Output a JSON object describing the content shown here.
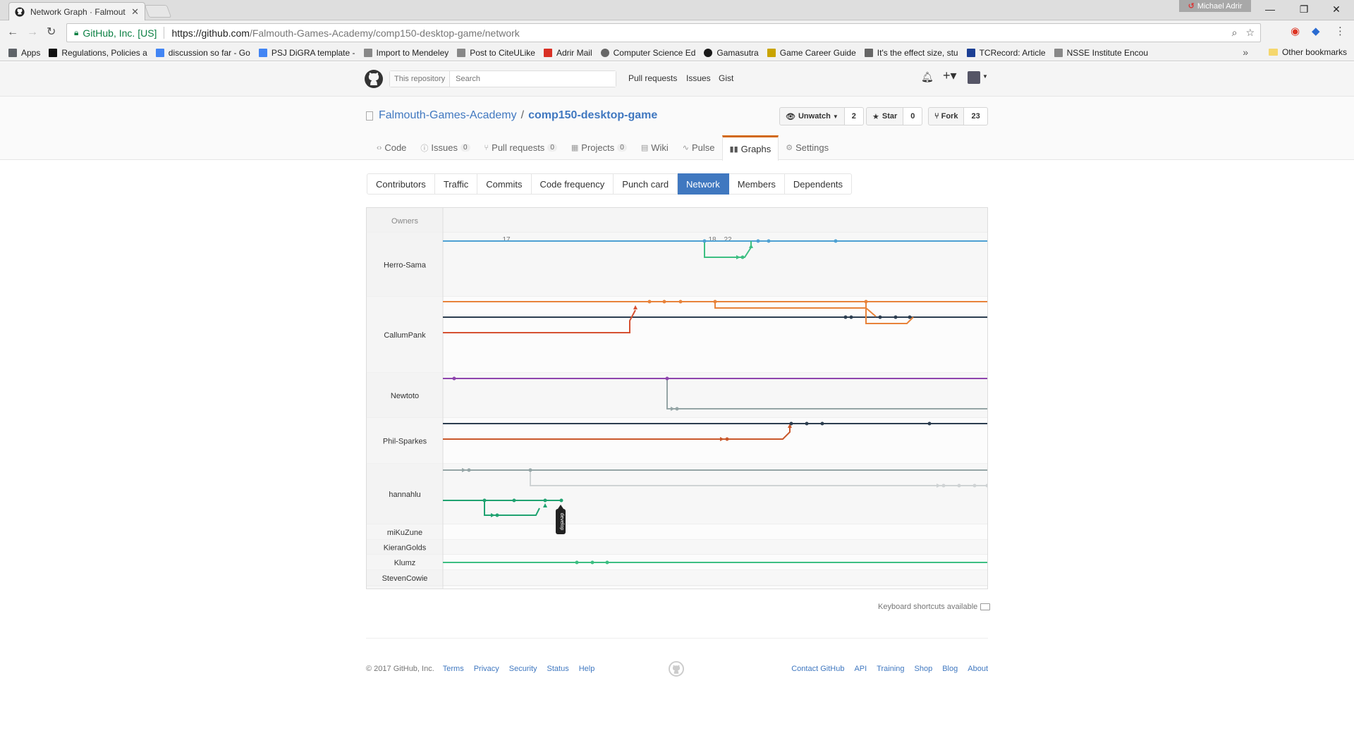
{
  "browser": {
    "tab_title": "Network Graph · Falmout",
    "profile_name": "Michael Adrir",
    "security_label": "GitHub, Inc. [US]",
    "url_host": "https://github.com",
    "url_path": "/Falmouth-Games-Academy/comp150-desktop-game/network",
    "bookmarks": [
      {
        "label": "Apps",
        "icon": "apps-grid-icon"
      },
      {
        "label": "Regulations, Policies a",
        "icon": "falmouth-icon"
      },
      {
        "label": "discussion so far - Go",
        "icon": "docs-icon"
      },
      {
        "label": "PSJ DiGRA template -",
        "icon": "docs-icon"
      },
      {
        "label": "Import to Mendeley",
        "icon": "page-icon"
      },
      {
        "label": "Post to CiteULike",
        "icon": "page-icon"
      },
      {
        "label": "Adrir Mail",
        "icon": "gmail-icon"
      },
      {
        "label": "Computer Science Ed",
        "icon": "globe-icon"
      },
      {
        "label": "Gamasutra",
        "icon": "gamasutra-icon"
      },
      {
        "label": "Game Career Guide",
        "icon": "gcg-icon"
      },
      {
        "label": "It's the effect size, stu",
        "icon": "pdf-icon"
      },
      {
        "label": "TCRecord: Article",
        "icon": "tc-icon"
      },
      {
        "label": "NSSE Institute Encou",
        "icon": "page-icon"
      }
    ],
    "other_bookmarks": "Other bookmarks"
  },
  "github": {
    "search_scope": "This repository",
    "search_placeholder": "Search",
    "nav": [
      "Pull requests",
      "Issues",
      "Gist"
    ],
    "repo_owner": "Falmouth-Games-Academy",
    "repo_name": "comp150-desktop-game",
    "unwatch_label": "Unwatch",
    "watch_count": "2",
    "star_label": "Star",
    "star_count": "0",
    "fork_label": "Fork",
    "fork_count": "23",
    "reponav": [
      {
        "label": "Code",
        "icon": "code-icon",
        "count": null
      },
      {
        "label": "Issues",
        "icon": "issue-icon",
        "count": "0"
      },
      {
        "label": "Pull requests",
        "icon": "pull-request-icon",
        "count": "0"
      },
      {
        "label": "Projects",
        "icon": "project-icon",
        "count": "0"
      },
      {
        "label": "Wiki",
        "icon": "wiki-icon",
        "count": null
      },
      {
        "label": "Pulse",
        "icon": "pulse-icon",
        "count": null
      },
      {
        "label": "Graphs",
        "icon": "graph-icon",
        "count": null,
        "selected": true
      },
      {
        "label": "Settings",
        "icon": "gear-icon",
        "count": null
      }
    ],
    "subnav": [
      {
        "label": "Contributors"
      },
      {
        "label": "Traffic"
      },
      {
        "label": "Commits"
      },
      {
        "label": "Code frequency"
      },
      {
        "label": "Punch card"
      },
      {
        "label": "Network",
        "selected": true
      },
      {
        "label": "Members"
      },
      {
        "label": "Dependents"
      }
    ]
  },
  "network": {
    "header": "Owners",
    "date_labels": [
      "17",
      "18",
      "22"
    ],
    "branch_label": "develop",
    "owners": [
      "Herro-Sama",
      "CallumPank",
      "Newtoto",
      "Phil-Sparkes",
      "hannahlu",
      "miKuZune",
      "KieranGolds",
      "Klumz",
      "StevenCowie"
    ],
    "colors": {
      "blue": "#4ea1d3",
      "green": "#3dbf82",
      "orange": "#e8833a",
      "navy": "#2c3e50",
      "red": "#d65132",
      "purple": "#8e44ad",
      "gray": "#95a5a6",
      "lightgray": "#cfd3d4",
      "darkorange": "#c9582b",
      "teal": "#20a371"
    }
  },
  "keyboard_note": "Keyboard shortcuts available",
  "footer": {
    "copyright": "© 2017 GitHub, Inc.",
    "left_links": [
      "Terms",
      "Privacy",
      "Security",
      "Status",
      "Help"
    ],
    "right_links": [
      "Contact GitHub",
      "API",
      "Training",
      "Shop",
      "Blog",
      "About"
    ]
  }
}
